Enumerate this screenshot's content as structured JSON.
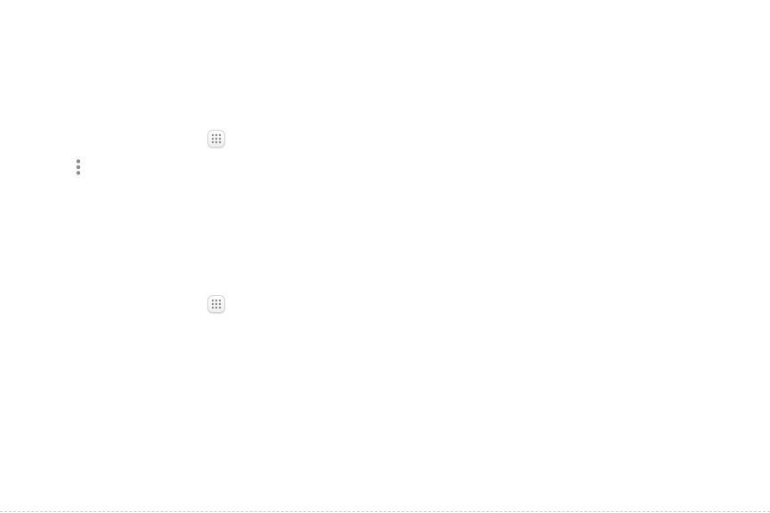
{
  "icons": {
    "apps_icon_first": "apps-grid-icon",
    "more_options_icon": "more-options-vertical-icon",
    "apps_icon_second": "apps-grid-icon"
  },
  "colors": {
    "background": "#ffffff",
    "icon_dot": "#8a8a8a",
    "icon_border": "#d4d4d4",
    "more_dots": "#8c8c8c"
  }
}
